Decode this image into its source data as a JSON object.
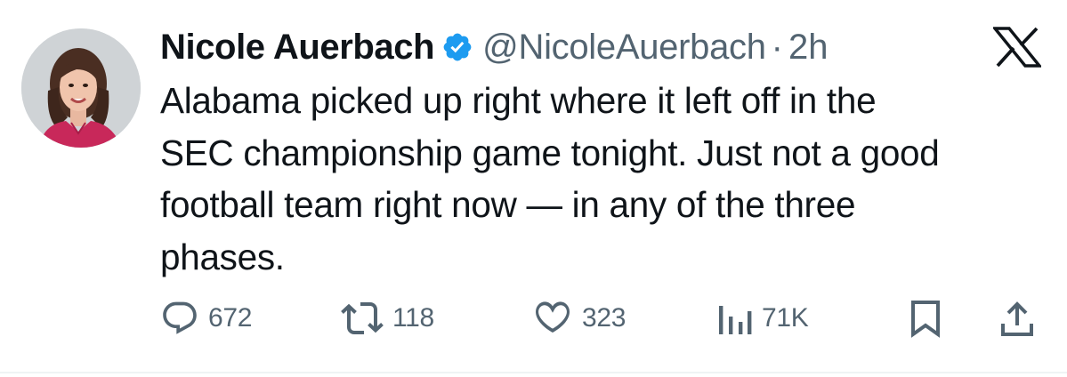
{
  "author": {
    "name": "Nicole Auerbach",
    "handle": "@NicoleAuerbach",
    "separator": "·",
    "time": "2h",
    "verified_icon": "verified-badge-icon",
    "verified_color": "#1d9bf0"
  },
  "tweet": {
    "lines": [
      "Alabama picked up right where it left off in the",
      "SEC championship game tonight. Just not a good",
      "football team right now — in any of the three",
      "phases."
    ]
  },
  "actions": {
    "reply": {
      "icon": "reply-icon",
      "count": "672"
    },
    "retweet": {
      "icon": "retweet-icon",
      "count": "118"
    },
    "like": {
      "icon": "heart-icon",
      "count": "323"
    },
    "views": {
      "icon": "views-icon",
      "count": "71K"
    },
    "bookmark": {
      "icon": "bookmark-icon"
    },
    "share": {
      "icon": "share-icon"
    }
  },
  "brand": {
    "logo": "x-logo-icon"
  },
  "colors": {
    "text": "#0f1419",
    "secondary": "#536471",
    "accent": "#1d9bf0"
  }
}
